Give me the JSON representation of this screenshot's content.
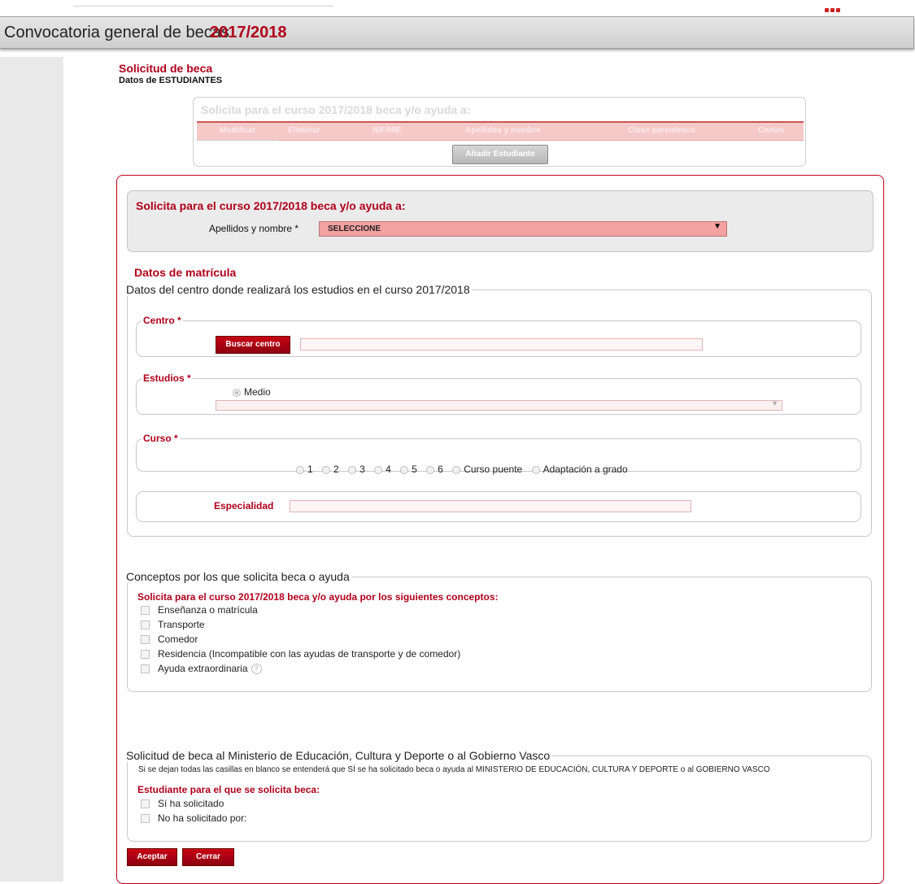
{
  "header": {
    "title": "Convocatoria general de becas",
    "year": "2017/2018"
  },
  "form": {
    "title": "Solicitud de beca",
    "subtitle": "Datos de ESTUDIANTES"
  },
  "students": {
    "header": "Solicita para el curso 2017/2018 beca y/o ayuda a:",
    "columns": [
      "Modificar",
      "Eliminar",
      "NIF/NIE",
      "Apellidos y nombre",
      "Clase parentesco",
      "Centro"
    ],
    "add_button": "Añadir Estudiante"
  },
  "selection": {
    "header": "Solicita para el curso 2017/2018 beca y/o ayuda a:",
    "label": "Apellidos y nombre *",
    "value": "SELECCIONE"
  },
  "matricula": {
    "title": "Datos de matrícula",
    "legend": "Datos del centro donde realizará los estudios en el curso 2017/2018",
    "centro": {
      "legend": "Centro *",
      "button": "Buscar centro",
      "value": ""
    },
    "estudios": {
      "legend": "Estudios *",
      "option": "Medio",
      "value": ""
    },
    "curso": {
      "legend": "Curso *",
      "options": [
        "1",
        "2",
        "3",
        "4",
        "5",
        "6",
        "Curso puente",
        "Adaptación a grado"
      ]
    },
    "especialidad": {
      "label": "Especialidad",
      "value": ""
    }
  },
  "conceptos": {
    "legend": "Conceptos por los que solicita beca o ayuda",
    "heading": "Solicita para el curso 2017/2018 beca y/o ayuda por los siguientes conceptos:",
    "items": [
      "Enseñanza o matrícula",
      "Transporte",
      "Comedor",
      "Residencia (Incompatible con las ayudas de transporte y de comedor)",
      "Ayuda extraordinaria"
    ]
  },
  "ministerio": {
    "legend": "Solicitud de beca al Ministerio de Educación, Cultura y Deporte o al Gobierno Vasco",
    "note": "Si se dejan todas las casillas en blanco se entenderá que SÍ se ha solicitado beca o ayuda al MINISTERIO DE EDUCACIÓN, CULTURA Y DEPORTE o al GOBIERNO VASCO",
    "heading": "Estudiante para el que se solicita beca:",
    "options": [
      "Sí ha solicitado",
      "No ha solicitado por:"
    ]
  },
  "actions": {
    "accept": "Aceptar",
    "close": "Cerrar"
  },
  "colors": {
    "accent": "#b0001a",
    "button_red": "#a80012",
    "select_bg": "#f3a1a1"
  }
}
